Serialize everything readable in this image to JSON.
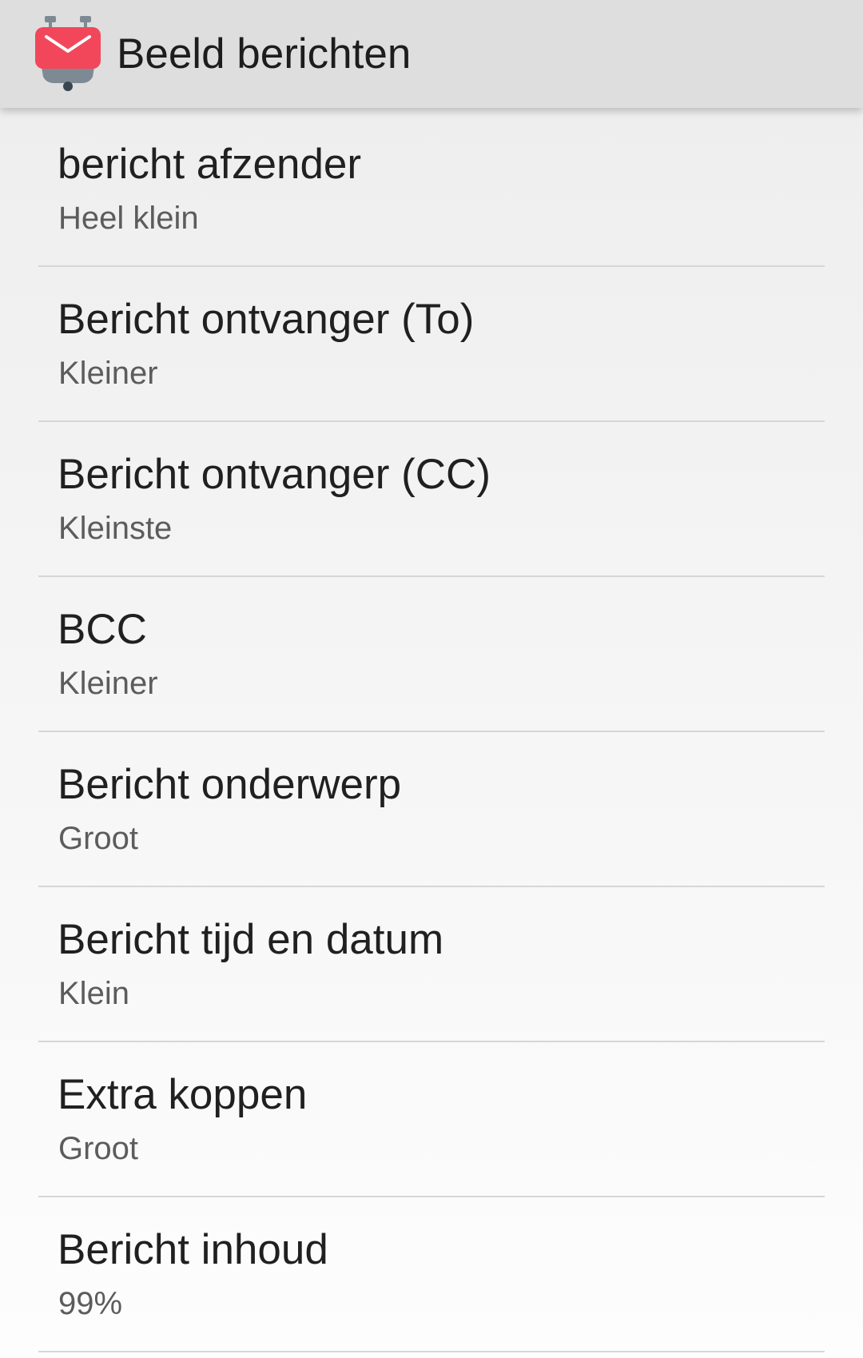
{
  "header": {
    "title": "Beeld berichten",
    "logo_icon": "k9-mail-logo-icon",
    "logo_color": "#f2475b"
  },
  "preferences": [
    {
      "title": "bericht afzender",
      "summary": "Heel klein"
    },
    {
      "title": "Bericht ontvanger (To)",
      "summary": "Kleiner"
    },
    {
      "title": "Bericht ontvanger (CC)",
      "summary": "Kleinste"
    },
    {
      "title": "BCC",
      "summary": "Kleiner"
    },
    {
      "title": "Bericht onderwerp",
      "summary": "Groot"
    },
    {
      "title": "Bericht tijd en datum",
      "summary": "Klein"
    },
    {
      "title": "Extra koppen",
      "summary": "Groot"
    },
    {
      "title": "Bericht inhoud",
      "summary": "99%"
    }
  ]
}
